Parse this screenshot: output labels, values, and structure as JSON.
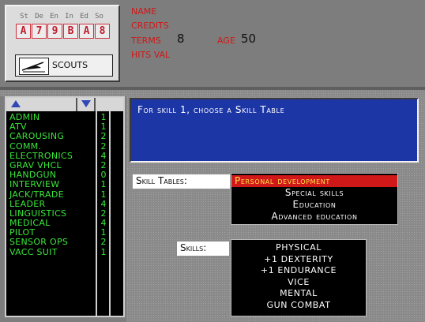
{
  "stats": {
    "headers": [
      "St",
      "De",
      "En",
      "In",
      "Ed",
      "So"
    ],
    "values": [
      "A",
      "7",
      "9",
      "B",
      "A",
      "8"
    ]
  },
  "service": {
    "label": "SCOUTS",
    "emblem": "scout-ship-emblem"
  },
  "info": {
    "name_label": "NAME",
    "credits_label": "CREDITS",
    "terms_label": "TERMS",
    "terms_value": "8",
    "age_label": "AGE",
    "age_value": "50",
    "hits_label": "HITS VAL"
  },
  "skill_list": [
    {
      "name": "ADMIN",
      "level": "1"
    },
    {
      "name": "ATV",
      "level": "1"
    },
    {
      "name": "CAROUSING",
      "level": "2"
    },
    {
      "name": "COMM.",
      "level": "2"
    },
    {
      "name": "ELECTRONICS",
      "level": "4"
    },
    {
      "name": "GRAV VHCL",
      "level": "2"
    },
    {
      "name": "HANDGUN",
      "level": "0"
    },
    {
      "name": "INTERVIEW",
      "level": "1"
    },
    {
      "name": "JACK/TRADE",
      "level": "1"
    },
    {
      "name": "LEADER",
      "level": "4"
    },
    {
      "name": "LINGUISTICS",
      "level": "2"
    },
    {
      "name": "MEDICAL",
      "level": "4"
    },
    {
      "name": "PILOT",
      "level": "1"
    },
    {
      "name": "SENSOR OPS",
      "level": "2"
    },
    {
      "name": "VACC SUIT",
      "level": "1"
    }
  ],
  "message": "For skill 1, choose a Skill Table",
  "skill_tables": {
    "label": "Skill Tables:",
    "options": [
      "Personal development",
      "Special skills",
      "Education",
      "Advanced education"
    ],
    "selected": "Personal development"
  },
  "skills": {
    "label": "Skills:",
    "options": [
      "PHYSICAL",
      "+1 DEXTERITY",
      "+1 ENDURANCE",
      "VICE",
      "MENTAL",
      "GUN COMBAT"
    ]
  },
  "colors": {
    "label_red": "#d01818",
    "skill_green": "#39e639",
    "message_blue": "#1d36a6",
    "selection_red": "#d01818",
    "selection_yellow": "#ffe14a"
  }
}
